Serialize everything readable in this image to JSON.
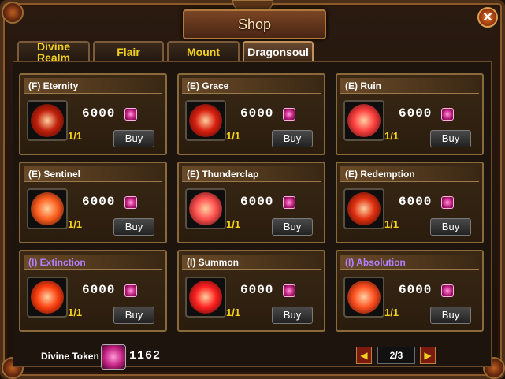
{
  "title": "Shop",
  "close_label": "✕",
  "tabs": [
    {
      "label": "Divine\nRealm",
      "active": false
    },
    {
      "label": "Flair",
      "active": false
    },
    {
      "label": "Mount",
      "active": false
    },
    {
      "label": "Dragonsoul",
      "active": true
    }
  ],
  "items": [
    {
      "name": "(F) Eternity",
      "price": "6000",
      "stock": "1/1",
      "buy": "Buy",
      "purple": false,
      "orb": "#c0200a"
    },
    {
      "name": "(E) Grace",
      "price": "6000",
      "stock": "1/1",
      "buy": "Buy",
      "purple": false,
      "orb": "#d82010"
    },
    {
      "name": "(E) Ruin",
      "price": "6000",
      "stock": "1/1",
      "buy": "Buy",
      "purple": false,
      "orb": "#ff4040"
    },
    {
      "name": "(E) Sentinel",
      "price": "6000",
      "stock": "1/1",
      "buy": "Buy",
      "purple": false,
      "orb": "#ff6020"
    },
    {
      "name": "(E) Thunderclap",
      "price": "6000",
      "stock": "1/1",
      "buy": "Buy",
      "purple": false,
      "orb": "#ff5050"
    },
    {
      "name": "(E) Redemption",
      "price": "6000",
      "stock": "1/1",
      "buy": "Buy",
      "purple": false,
      "orb": "#e03010"
    },
    {
      "name": "(I) Extinction",
      "price": "6000",
      "stock": "1/1",
      "buy": "Buy",
      "purple": true,
      "orb": "#ff4010"
    },
    {
      "name": "(I) Summon",
      "price": "6000",
      "stock": "1/1",
      "buy": "Buy",
      "purple": false,
      "orb": "#ff2020"
    },
    {
      "name": "(I) Absolution",
      "price": "6000",
      "stock": "1/1",
      "buy": "Buy",
      "purple": true,
      "orb": "#ff5020"
    }
  ],
  "footer": {
    "token_label": "Divine Token",
    "token_count": "1162",
    "page": "2/3",
    "prev_icon": "◀",
    "next_icon": "▶"
  }
}
